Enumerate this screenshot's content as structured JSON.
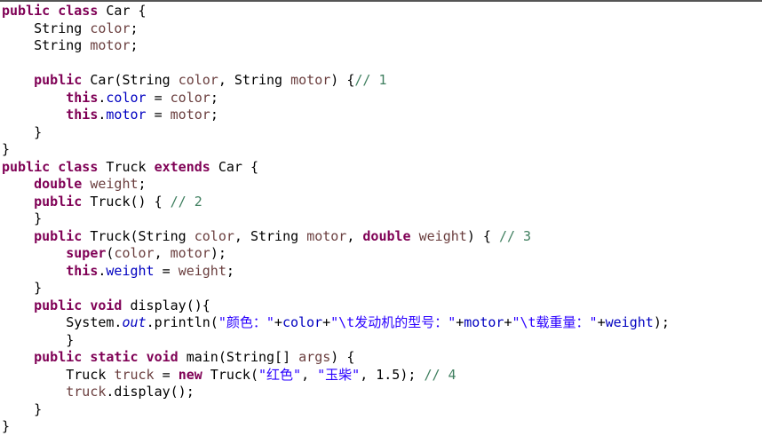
{
  "code": {
    "l1": {
      "kw1": "public",
      "kw2": "class",
      "cls": "Car",
      "brace": " {"
    },
    "l2": {
      "typ": "String",
      "id": "color",
      "semi": ";"
    },
    "l3": {
      "typ": "String",
      "id": "motor",
      "semi": ";"
    },
    "l4": "",
    "l5": {
      "kw": "public",
      "ctor": "Car(String ",
      "p1": "color",
      "c": ", String ",
      "p2": "motor",
      "tail": ") {",
      "cmt": "// 1"
    },
    "l6": {
      "kw": "this",
      "dot": ".",
      "fld": "color",
      "eq": " = ",
      "var": "color",
      "semi": ";"
    },
    "l7": {
      "kw": "this",
      "dot": ".",
      "fld": "motor",
      "eq": " = ",
      "var": "motor",
      "semi": ";"
    },
    "l8": {
      "brace": "}"
    },
    "l9": {
      "brace": "}"
    },
    "l10": {
      "kw1": "public",
      "kw2": "class",
      "cls": "Truck",
      "kw3": "extends",
      "sup": "Car",
      "brace": " {"
    },
    "l11": {
      "kw": "double",
      "id": "weight",
      "semi": ";"
    },
    "l12": {
      "kw": "public",
      "ctor": "Truck() { ",
      "cmt": "// 2"
    },
    "l13": {
      "brace": "}"
    },
    "l14": {
      "kw": "public",
      "ctor": "Truck(String ",
      "p1": "color",
      "c1": ", String ",
      "p2": "motor",
      "c2": ", ",
      "kwd": "double",
      "sp": " ",
      "p3": "weight",
      "tail": ") { ",
      "cmt": "// 3"
    },
    "l15": {
      "kw": "super",
      "args": "(",
      "v1": "color",
      "c": ", ",
      "v2": "motor",
      "end": ");"
    },
    "l16": {
      "kw": "this",
      "dot": ".",
      "fld": "weight",
      "eq": " = ",
      "var": "weight",
      "semi": ";"
    },
    "l17": {
      "brace": "}"
    },
    "l18": {
      "kw1": "public",
      "kw2": "void",
      "name": "display(){"
    },
    "l19": {
      "sys": "System.",
      "out": "out",
      "mid": ".println(",
      "s1": "\"颜色：\"",
      "p1": "+",
      "v1": "color",
      "p2": "+",
      "s2": "\"\\t发动机的型号：\"",
      "p3": "+",
      "v2": "motor",
      "p4": "+",
      "s3": "\"\\t载重量：\"",
      "p5": "+",
      "v3": "weight",
      "end": ");"
    },
    "l20": {
      "brace": "}"
    },
    "l21": {
      "kw1": "public",
      "kw2": "static",
      "kw3": "void",
      "name": "main(String[] ",
      "p": "args",
      "tail": ") {"
    },
    "l22": {
      "t": "Truck ",
      "v": "truck",
      "eq": " = ",
      "kw": "new",
      "ctor": " Truck(",
      "s1": "\"红色\"",
      "c1": ", ",
      "s2": "\"玉柴\"",
      "c2": ", 1.5); ",
      "cmt": "// 4"
    },
    "l23": {
      "v": "truck",
      "call": ".display();"
    },
    "l24": {
      "brace": "}"
    },
    "l25": {
      "brace": "}"
    }
  }
}
